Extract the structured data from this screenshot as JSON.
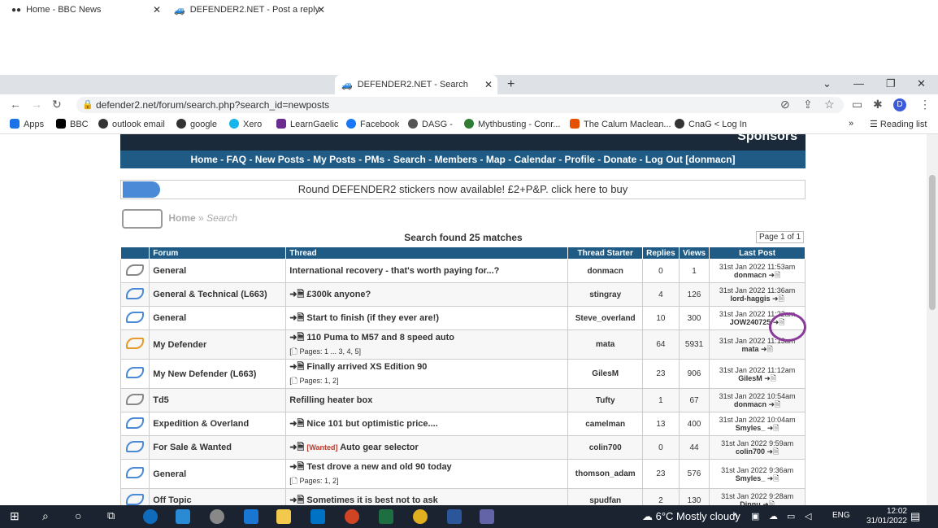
{
  "browser": {
    "tabs": [
      {
        "label": "Home - BBC News",
        "color": "#000000"
      },
      {
        "label": "DEFENDER2.NET - Post a reply",
        "color": "#222222"
      },
      {
        "label": "DEFENDER2.NET - Search",
        "color": "#222222"
      }
    ],
    "url": "defender2.net/forum/search.php?search_id=newposts",
    "bookmarks": [
      {
        "label": "Apps",
        "icon": "apps-grid-icon",
        "color": "#1a73e8"
      },
      {
        "label": "BBC",
        "icon": "bbc-icon",
        "color": "#000000"
      },
      {
        "label": "outlook email",
        "icon": "outlook-icon",
        "color": "#333333"
      },
      {
        "label": "google",
        "icon": "google-icon",
        "color": "#333333"
      },
      {
        "label": "Xero",
        "icon": "xero-icon",
        "color": "#13b5ea"
      },
      {
        "label": "LearnGaelic",
        "icon": "learngaelic-icon",
        "color": "#6a2c91"
      },
      {
        "label": "Facebook",
        "icon": "facebook-icon",
        "color": "#1877f2"
      },
      {
        "label": "DASG -",
        "icon": "dasg-icon",
        "color": "#555555"
      },
      {
        "label": "Mythbusting - Conr...",
        "icon": "mythbusting-icon",
        "color": "#2e7d32"
      },
      {
        "label": "The Calum Maclean...",
        "icon": "calum-icon",
        "color": "#e65100"
      },
      {
        "label": "CnaG < Log In",
        "icon": "cnag-icon",
        "color": "#333333"
      }
    ],
    "reading_list": "Reading list"
  },
  "site": {
    "banner_text": "Sponsors",
    "nav": "Home - FAQ - New Posts - My Posts - PMs - Search - Members - Map - Calendar - Profile - Donate - Log Out [donmacn]",
    "notice": "Round DEFENDER2 stickers now available! £2+P&P. click here to buy",
    "breadcrumb_home": "Home",
    "breadcrumb_sep": "»",
    "breadcrumb_search": "Search",
    "found": "Search found 25 matches",
    "page_info": "Page 1 of 1"
  },
  "table": {
    "headers": [
      "Forum",
      "Thread",
      "Thread Starter",
      "Replies",
      "Views",
      "Last Post"
    ],
    "rows": [
      {
        "icon": "gray",
        "forum": "General",
        "prefix": "",
        "tag": "",
        "thread": "International recovery - that's worth paying for...?",
        "pages": "",
        "starter": "donmacn",
        "replies": "0",
        "views": "1",
        "last_date": "31st Jan 2022 11:53am",
        "last_user": "donmacn"
      },
      {
        "icon": "blue",
        "forum": "General & Technical (L663)",
        "prefix": "➜🗎",
        "tag": "",
        "thread": "£300k anyone?",
        "pages": "",
        "starter": "stingray",
        "replies": "4",
        "views": "126",
        "last_date": "31st Jan 2022 11:36am",
        "last_user": "lord-haggis"
      },
      {
        "icon": "blue",
        "forum": "General",
        "prefix": "➜🗎",
        "tag": "",
        "thread": "Start to finish (if they ever are!)",
        "pages": "",
        "starter": "Steve_overland",
        "replies": "10",
        "views": "300",
        "last_date": "31st Jan 2022 11:22am",
        "last_user": "JOW240725"
      },
      {
        "icon": "orange",
        "forum": "My Defender",
        "prefix": "➜🗎",
        "tag": "",
        "thread": "110 Puma to M57 and 8 speed auto",
        "pages": "[🗋 Pages: 1 ... 3, 4, 5]",
        "starter": "mata",
        "replies": "64",
        "views": "5931",
        "last_date": "31st Jan 2022 11:13am",
        "last_user": "mata"
      },
      {
        "icon": "blue",
        "forum": "My New Defender (L663)",
        "prefix": "➜🗎",
        "tag": "",
        "thread": "Finally arrived XS Edition 90",
        "pages": "[🗋 Pages: 1, 2]",
        "starter": "GilesM",
        "replies": "23",
        "views": "906",
        "last_date": "31st Jan 2022 11:12am",
        "last_user": "GilesM"
      },
      {
        "icon": "gray",
        "forum": "Td5",
        "prefix": "",
        "tag": "",
        "thread": "Refilling heater box",
        "pages": "",
        "starter": "Tufty",
        "replies": "1",
        "views": "67",
        "last_date": "31st Jan 2022 10:54am",
        "last_user": "donmacn"
      },
      {
        "icon": "blue",
        "forum": "Expedition & Overland",
        "prefix": "➜🗎",
        "tag": "",
        "thread": "Nice 101 but optimistic price....",
        "pages": "",
        "starter": "camelman",
        "replies": "13",
        "views": "400",
        "last_date": "31st Jan 2022 10:04am",
        "last_user": "Smyles_"
      },
      {
        "icon": "blue",
        "forum": "For Sale & Wanted",
        "prefix": "➜🗎",
        "tag": "[Wanted]",
        "thread": "Auto gear selector",
        "pages": "",
        "starter": "colin700",
        "replies": "0",
        "views": "44",
        "last_date": "31st Jan 2022 9:59am",
        "last_user": "colin700"
      },
      {
        "icon": "blue",
        "forum": "General",
        "prefix": "➜🗎",
        "tag": "",
        "thread": "Test drove a new and old 90 today",
        "pages": "[🗋 Pages: 1, 2]",
        "starter": "thomson_adam",
        "replies": "23",
        "views": "576",
        "last_date": "31st Jan 2022 9:36am",
        "last_user": "Smyles_"
      },
      {
        "icon": "blue",
        "forum": "Off Topic",
        "prefix": "➜🗎",
        "tag": "",
        "thread": "Sometimes it is best not to ask",
        "pages": "",
        "starter": "spudfan",
        "replies": "2",
        "views": "130",
        "last_date": "31st Jan 2022 9:28am",
        "last_user": "Dinnu"
      }
    ]
  },
  "taskbar": {
    "weather": "6°C  Mostly cloudy",
    "lang": "ENG",
    "time": "12:02",
    "date": "31/01/2022"
  }
}
